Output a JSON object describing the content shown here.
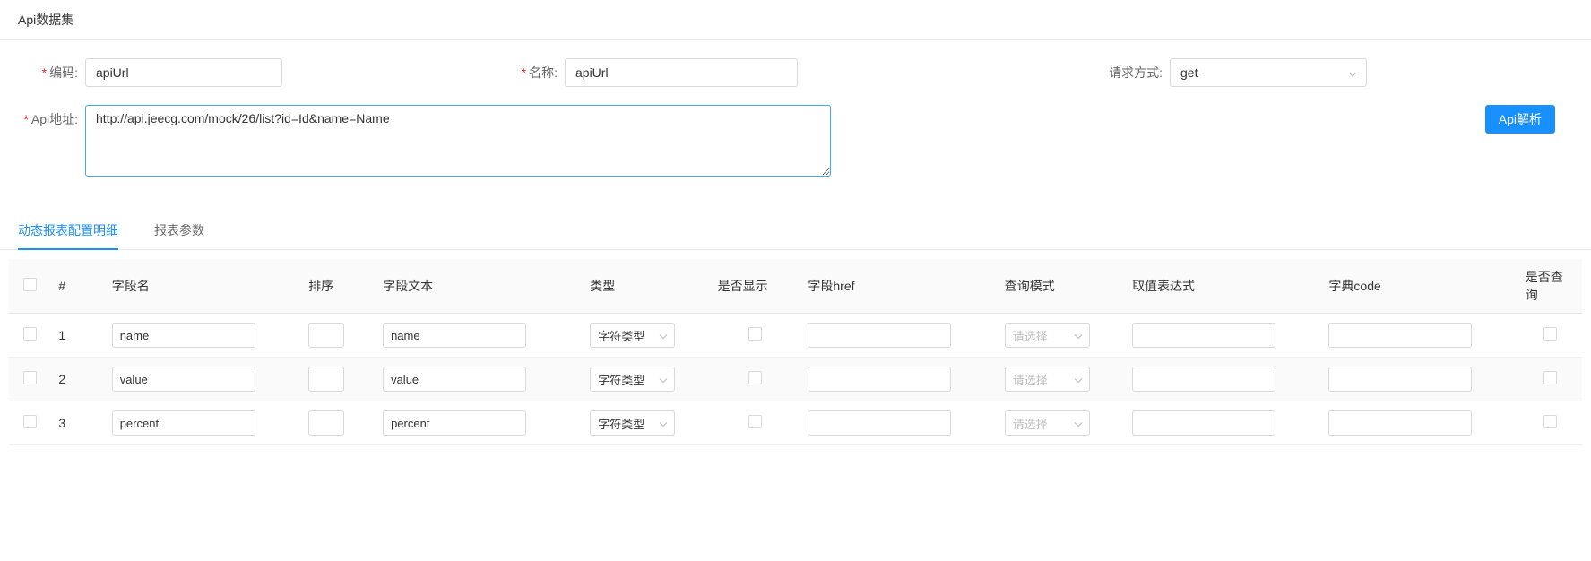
{
  "header": {
    "title": "Api数据集"
  },
  "form": {
    "code_label": "编码:",
    "code_value": "apiUrl",
    "name_label": "名称:",
    "name_value": "apiUrl",
    "method_label": "请求方式:",
    "method_value": "get",
    "url_label": "Api地址:",
    "url_value": "http://api.jeecg.com/mock/26/list?id=Id&name=Name",
    "parse_btn": "Api解析"
  },
  "tabs": {
    "t1": "动态报表配置明细",
    "t2": "报表参数"
  },
  "table": {
    "headers": {
      "idx": "#",
      "field_name": "字段名",
      "sort": "排序",
      "field_text": "字段文本",
      "type": "类型",
      "is_show": "是否显示",
      "href": "字段href",
      "query_mode": "查询模式",
      "expr": "取值表达式",
      "dict": "字典code",
      "is_query": "是否查询"
    },
    "rows": [
      {
        "idx": "1",
        "field_name": "name",
        "sort": "",
        "field_text": "name",
        "type": "字符类型",
        "is_show": false,
        "href": "",
        "query_mode_placeholder": "请选择",
        "expr": "",
        "dict": "",
        "is_query": false
      },
      {
        "idx": "2",
        "field_name": "value",
        "sort": "",
        "field_text": "value",
        "type": "字符类型",
        "is_show": false,
        "href": "",
        "query_mode_placeholder": "请选择",
        "expr": "",
        "dict": "",
        "is_query": false
      },
      {
        "idx": "3",
        "field_name": "percent",
        "sort": "",
        "field_text": "percent",
        "type": "字符类型",
        "is_show": false,
        "href": "",
        "query_mode_placeholder": "请选择",
        "expr": "",
        "dict": "",
        "is_query": false
      }
    ]
  }
}
